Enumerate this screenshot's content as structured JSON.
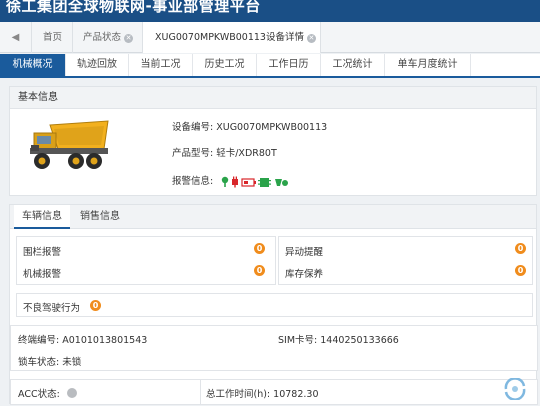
{
  "app": {
    "title": "徐工集团全球物联网-事业部管理平台"
  },
  "page_tabs": {
    "back": "◀",
    "items": [
      {
        "label": "首页",
        "closable": false,
        "active": false
      },
      {
        "label": "产品状态",
        "closable": true,
        "active": false
      },
      {
        "label": "XUG0070MPKWB00113设备详情",
        "closable": true,
        "active": true
      }
    ]
  },
  "sub_tabs": [
    {
      "label": "机械概况",
      "active": true
    },
    {
      "label": "轨迹回放",
      "active": false
    },
    {
      "label": "当前工况",
      "active": false
    },
    {
      "label": "历史工况",
      "active": false
    },
    {
      "label": "工作日历",
      "active": false
    },
    {
      "label": "工况统计",
      "active": false
    },
    {
      "label": "单车月度统计",
      "active": false
    }
  ],
  "basic_info": {
    "header": "基本信息",
    "device_no_label": "设备编号:",
    "device_no": "XUG0070MPKWB00113",
    "model_label": "产品型号:",
    "model": "轻卡/XDR80T",
    "alarm_label": "报警信息:",
    "colors": {
      "truck_body": "#f2b01e",
      "truck_cab": "#d9a019"
    }
  },
  "detail_tabs": [
    {
      "label": "车辆信息",
      "active": true
    },
    {
      "label": "销售信息",
      "active": false
    }
  ],
  "alarms": {
    "fence": {
      "label": "围栏报警",
      "count": "0"
    },
    "abnormal": {
      "label": "异动提醒",
      "count": "0"
    },
    "machine": {
      "label": "机械报警",
      "count": "0"
    },
    "stock": {
      "label": "库存保养",
      "count": "0"
    },
    "bad_driving": {
      "label": "不良驾驶行为",
      "count": "0"
    },
    "badge_color": "#f08c1c"
  },
  "terminal": {
    "terminal_no_label": "终端编号:",
    "terminal_no": "A0101013801543",
    "sim_label": "SIM卡号:",
    "sim": "1440250133666",
    "lock_label": "锁车状态:",
    "lock": "未锁",
    "acc_label": "ACC状态:",
    "work_hours_label": "总工作时间(h):",
    "work_hours": "10782.30"
  }
}
